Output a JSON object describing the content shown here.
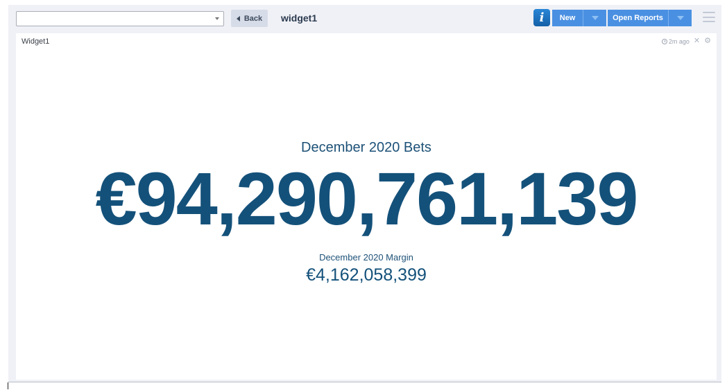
{
  "toolbar": {
    "select_value": "",
    "back_label": "Back",
    "page_title": "widget1",
    "info_label": "i",
    "new_label": "New",
    "open_reports_label": "Open Reports"
  },
  "widget": {
    "name": "Widget1",
    "updated": "2m ago",
    "kpi_title": "December 2020 Bets",
    "kpi_value": "€94,290,761,139",
    "kpi_sub_title": "December 2020 Margin",
    "kpi_sub_value": "€4,162,058,399"
  },
  "icons": {
    "back": "caret-left-icon",
    "info": "info-icon",
    "dropdown": "chevron-down-icon",
    "menu": "hamburger-menu-icon",
    "clock": "clock-icon",
    "expand": "expand-icon",
    "settings": "gear-icon"
  },
  "colors": {
    "kpi": "#14517a",
    "primary_button": "#4a90e2",
    "background": "#f0f1f6"
  }
}
